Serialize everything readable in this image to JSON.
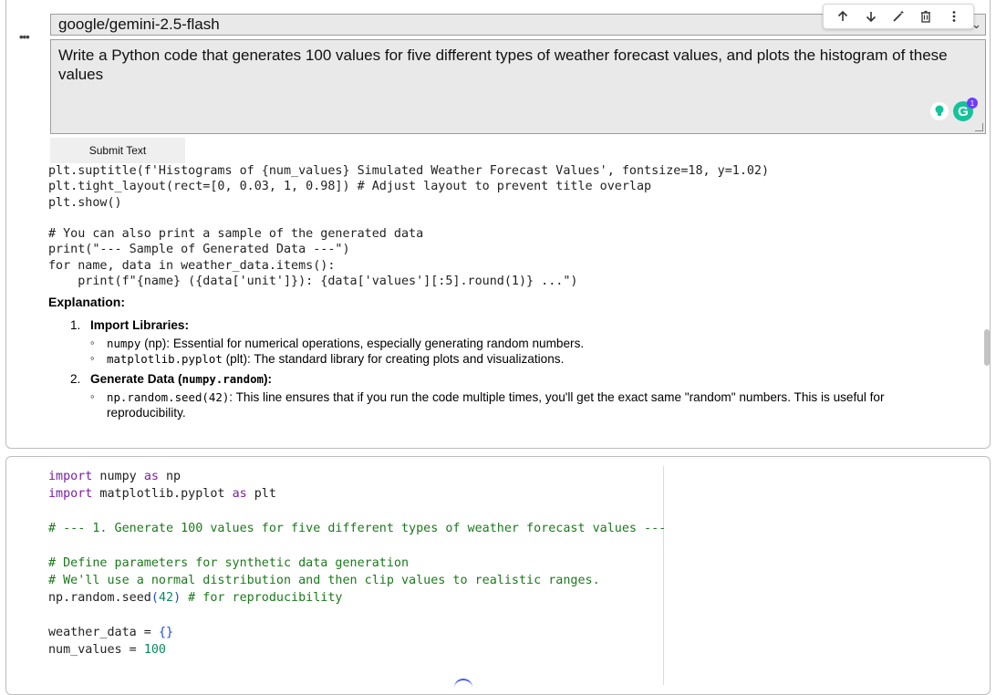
{
  "cell_top": {
    "more_label": "•••",
    "model_select": {
      "value": "google/gemini-2.5-flash"
    },
    "toolbar": {
      "icons": [
        "arrow-up-icon",
        "arrow-down-icon",
        "magic-wand-icon",
        "trash-icon",
        "more-vertical-icon"
      ]
    },
    "prompt": {
      "value": "Write a Python code that generates 100 values for five different types of weather forecast values, and plots the histogram of these values"
    },
    "grammarly_badge": "1",
    "submit_label": "Submit Text",
    "code_lines": [
      "plt.suptitle(f'Histograms of {num_values} Simulated Weather Forecast Values', fontsize=18, y=1.02)",
      "plt.tight_layout(rect=[0, 0.03, 1, 0.98]) # Adjust layout to prevent title overlap",
      "plt.show()",
      "",
      "# You can also print a sample of the generated data",
      "print(\"--- Sample of Generated Data ---\")",
      "for name, data in weather_data.items():",
      "    print(f\"{name} ({data['unit']}): {data['values'][:5].round(1)} ...\")"
    ],
    "explanation": {
      "heading": "Explanation:",
      "items": [
        {
          "number": "1.",
          "title": "Import Libraries:",
          "title_code": "",
          "subitems": [
            {
              "code": "numpy",
              "text": " (np): Essential for numerical operations, especially generating random numbers."
            },
            {
              "code": "matplotlib.pyplot",
              "text": " (plt): The standard library for creating plots and visualizations."
            }
          ]
        },
        {
          "number": "2.",
          "title": "Generate Data (",
          "title_code": "numpy.random",
          "title_end": "):",
          "subitems": [
            {
              "code": "np.random.seed(42)",
              "text": ": This line ensures that if you run the code multiple times, you'll get the exact same \"random\" numbers. This is useful for reproducibility."
            }
          ]
        }
      ]
    }
  },
  "cell_bottom": {
    "code": {
      "line1_kw1": "import",
      "line1_mod": " numpy ",
      "line1_kw2": "as",
      "line1_alias": " np",
      "line2_kw1": "import",
      "line2_mod": " matplotlib.pyplot ",
      "line2_kw2": "as",
      "line2_alias": " plt",
      "line4_comment": "# --- 1. Generate 100 values for five different types of weather forecast values ---",
      "line6_comment": "# Define parameters for synthetic data generation",
      "line7_comment": "# We'll use a normal distribution and then clip values to realistic ranges.",
      "line8_code": "np.random.seed",
      "line8_paren_open": "(",
      "line8_num": "42",
      "line8_paren_close": ")",
      "line8_comment": " # for reproducibility",
      "line10_var": "weather_data = ",
      "line10_val": "{}",
      "line11_var": "num_values = ",
      "line11_val": "100"
    }
  }
}
